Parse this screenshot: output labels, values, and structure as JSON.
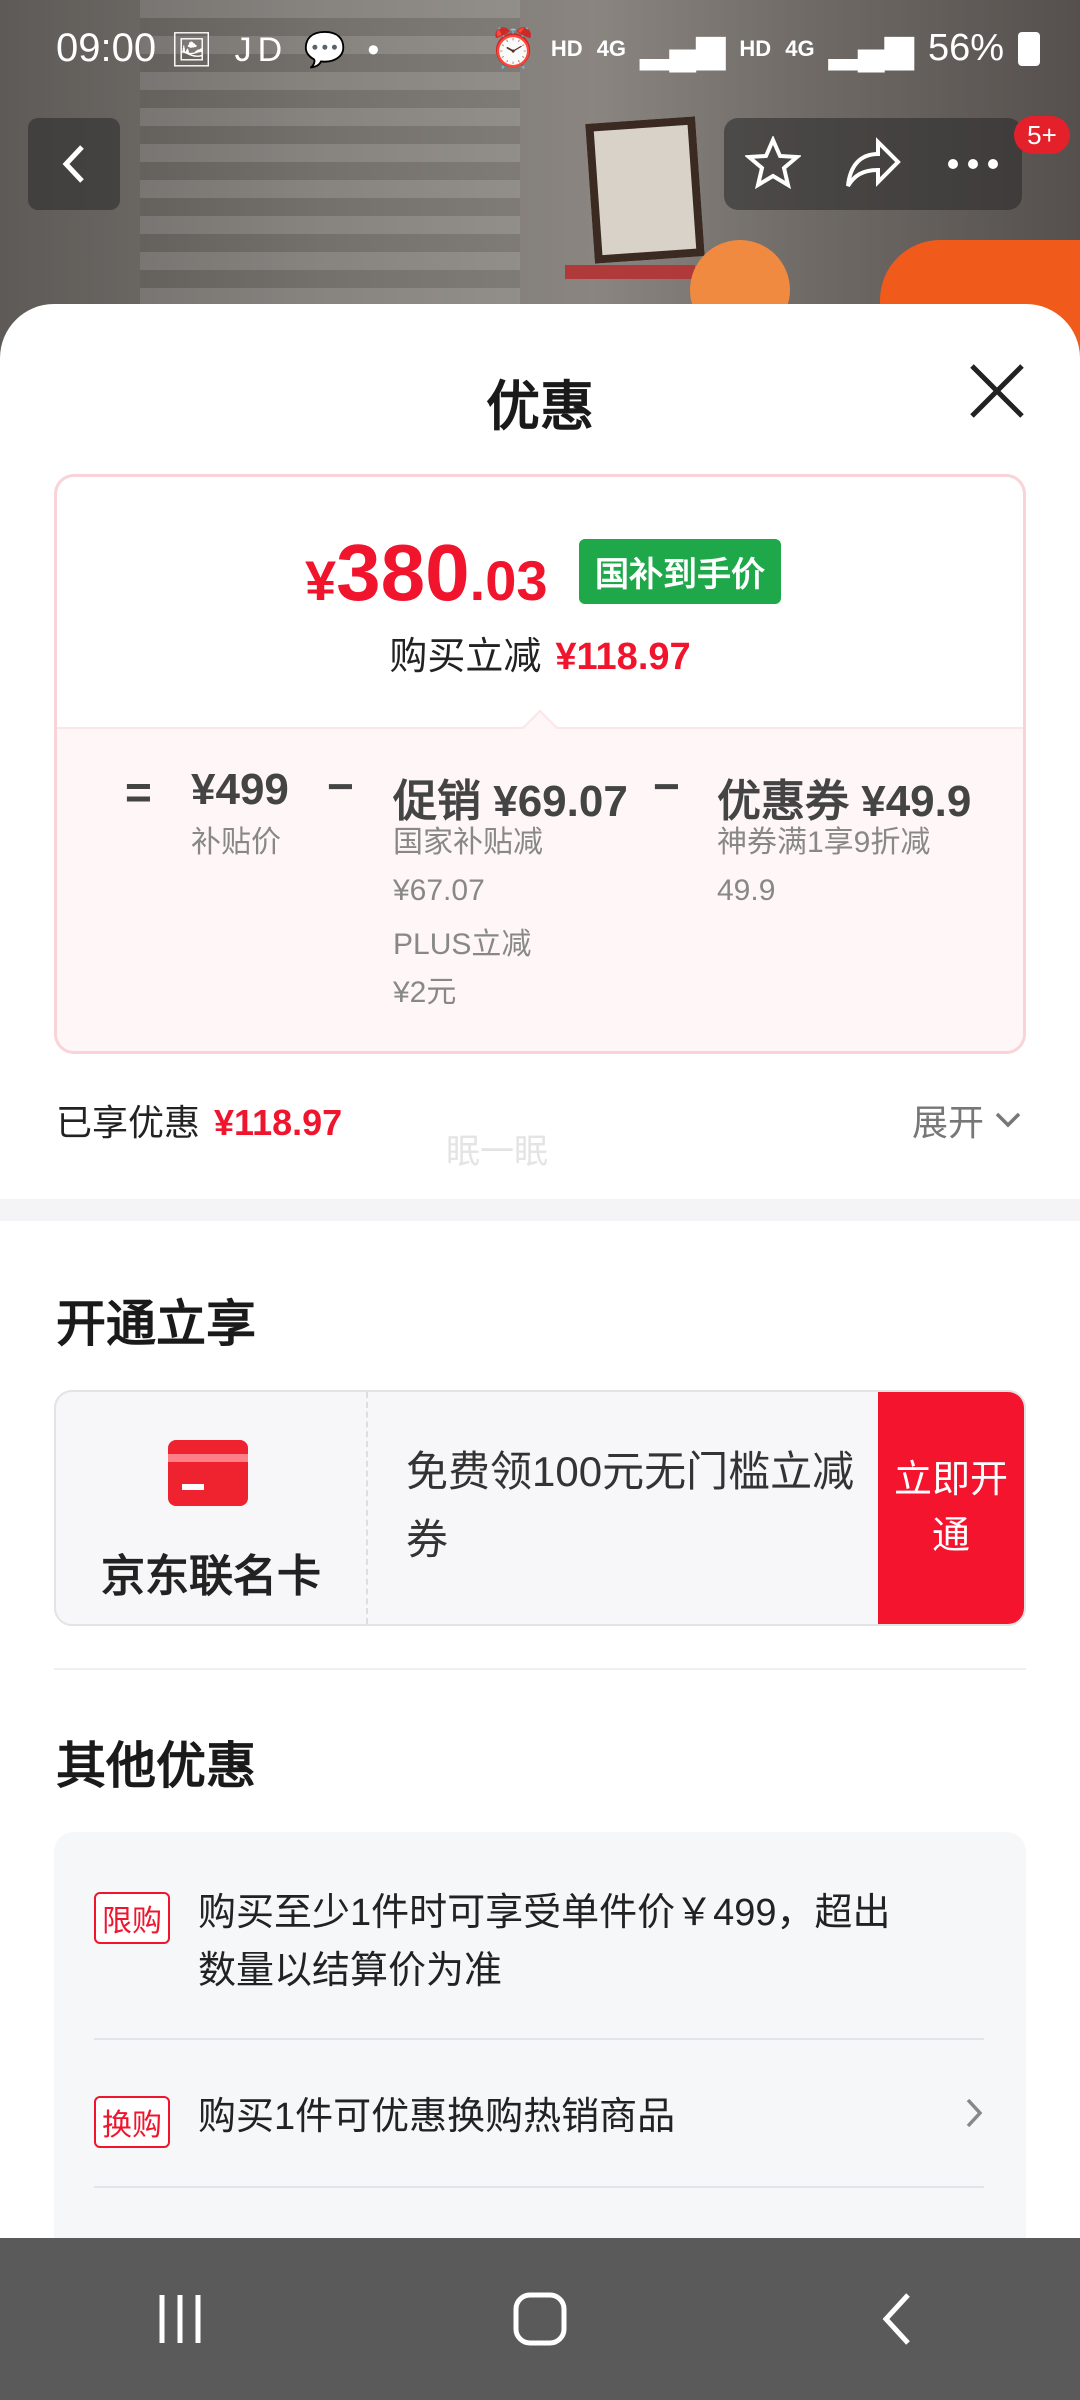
{
  "status_bar": {
    "time": "09:00",
    "left_icons": "🖼 JD 💬 •",
    "right_labels": [
      "HD",
      "4G",
      "HD",
      "4G"
    ],
    "battery": "56%"
  },
  "header": {
    "cart_badge": "5+"
  },
  "sheet": {
    "title": "优惠",
    "price": {
      "yen": "¥",
      "integer": "380",
      "decimal": ".03",
      "tag": "国补到手价"
    },
    "save_label": "购买立减",
    "save_value": "¥118.97",
    "breakdown": {
      "op_equal": "=",
      "base_price": "¥499",
      "base_label": "补贴价",
      "op_minus1": "−",
      "promo_main": "促销 ¥69.07",
      "promo_sub1": "国家补贴减",
      "promo_sub1_value": "¥67.07",
      "promo_sub2": "PLUS立减",
      "promo_sub2_value": "¥2元",
      "op_minus2": "−",
      "coupon_main": "优惠券 ¥49.9",
      "coupon_sub1": "神券满1享9折减",
      "coupon_sub1_value": "49.9"
    },
    "enjoyed_label": "已享优惠",
    "enjoyed_value": "¥118.97",
    "expand_label": "展开",
    "watermark": "眠一眠"
  },
  "open_section": {
    "title": "开通立享",
    "card_name": "京东联名卡",
    "card_desc": "免费领100元无门槛立减券",
    "button": "立即开通"
  },
  "other_section": {
    "title": "其他优惠",
    "items": [
      {
        "tag": "限购",
        "text": "购买至少1件时可享受单件价￥499，超出数量以结算价为准"
      },
      {
        "tag": "换购",
        "text": "购买1件可优惠换购热销商品"
      }
    ]
  },
  "colors": {
    "accent_red": "#f0142d",
    "tag_green": "#1ea84a",
    "button_red": "#f5142e"
  }
}
